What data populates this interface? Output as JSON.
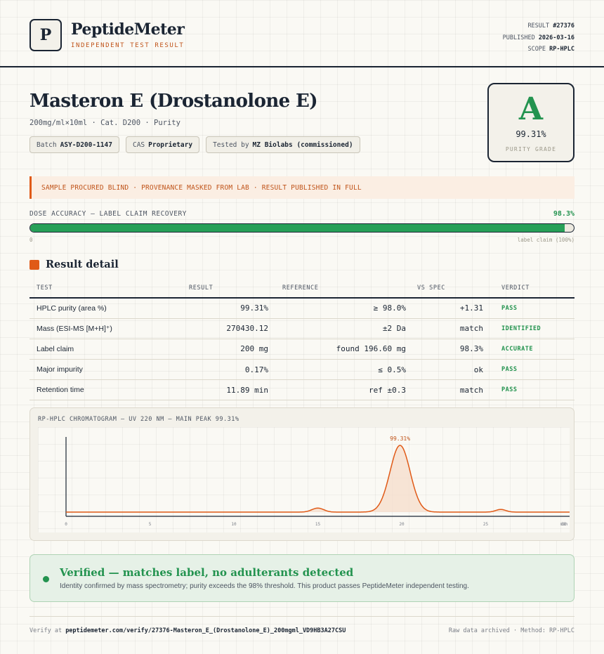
{
  "header": {
    "logo_letter": "P",
    "brand": "PeptideMeter",
    "tagline": "INDEPENDENT TEST RESULT",
    "result_label": "RESULT",
    "result_value": "#27376",
    "published_label": "PUBLISHED",
    "published_value": "2026-03-16",
    "scope_label": "SCOPE",
    "scope_value": "RP-HPLC"
  },
  "product": {
    "title": "Masteron E (Drostanolone E)",
    "subtitle": "200mg/ml×10ml · Cat. D200 · Purity",
    "chips": [
      {
        "label": "Batch",
        "value": "ASY-D200-1147"
      },
      {
        "label": "CAS",
        "value": "Proprietary"
      },
      {
        "label": "Tested by",
        "value": "MZ Biolabs (commissioned)"
      }
    ]
  },
  "grade": {
    "letter": "A",
    "value": "99.31%",
    "label": "PURITY GRADE",
    "color": "#23934f"
  },
  "notice": "SAMPLE PROCURED BLIND · PROVENANCE MASKED FROM LAB · RESULT PUBLISHED IN FULL",
  "dose": {
    "label": "DOSE ACCURACY — LABEL CLAIM RECOVERY",
    "percent_text": "98.3%",
    "fill_fraction": 0.983,
    "scale_min": "0",
    "scale_max": "label claim (100%)"
  },
  "section_title": "Result detail",
  "table": {
    "headers": [
      "TEST",
      "RESULT",
      "REFERENCE",
      "VS SPEC",
      "VERDICT"
    ],
    "rows": [
      {
        "test": "HPLC purity (area %)",
        "result": "99.31%",
        "reference": "≥ 98.0%",
        "vs": "+1.31",
        "verdict": "PASS"
      },
      {
        "test": "Mass (ESI-MS [M+H]⁺)",
        "result": "270430.12",
        "reference": "±2 Da",
        "vs": "match",
        "verdict": "IDENTIFIED"
      },
      {
        "test": "Label claim",
        "result": "200 mg",
        "reference": "found 196.60 mg",
        "vs": "98.3%",
        "verdict": "ACCURATE"
      },
      {
        "test": "Major impurity",
        "result": "0.17%",
        "reference": "≤ 0.5%",
        "vs": "ok",
        "verdict": "PASS"
      },
      {
        "test": "Retention time",
        "result": "11.89 min",
        "reference": "ref ±0.3",
        "vs": "match",
        "verdict": "PASS"
      }
    ]
  },
  "chromatogram": {
    "label": "RP-HPLC CHROMATOGRAM — UV 220 NM — MAIN PEAK 99.31%",
    "peak_label": "99.31%",
    "line_color": "#e05a17"
  },
  "chart_data": {
    "type": "line",
    "x_ticks": [
      "0",
      "5",
      "10",
      "15",
      "20",
      "25",
      "30",
      "min"
    ],
    "xlim": [
      0,
      30
    ],
    "series": [
      {
        "peaks": [
          {
            "x": 15.0,
            "height": 0.06,
            "width": 0.35
          },
          {
            "x": 19.9,
            "height": 1.0,
            "width": 0.6
          },
          {
            "x": 25.9,
            "height": 0.04,
            "width": 0.3
          }
        ]
      }
    ],
    "baseline": 0.0,
    "annotations": [
      {
        "x": 19.9,
        "text": "99.31%"
      }
    ]
  },
  "verified": {
    "title": "Verified — matches label, no adulterants detected",
    "subtitle": "Identity confirmed by mass spectrometry; purity exceeds the 98% threshold. This product passes PeptideMeter independent testing."
  },
  "footer": {
    "verify_prefix": "Verify at",
    "verify_url": "peptidemeter.com/verify/27376-Masteron_E_(Drostanolone_E)_200mgml_VD9HB3A27CSU",
    "right": "Raw data archived · Method: RP-HPLC"
  }
}
